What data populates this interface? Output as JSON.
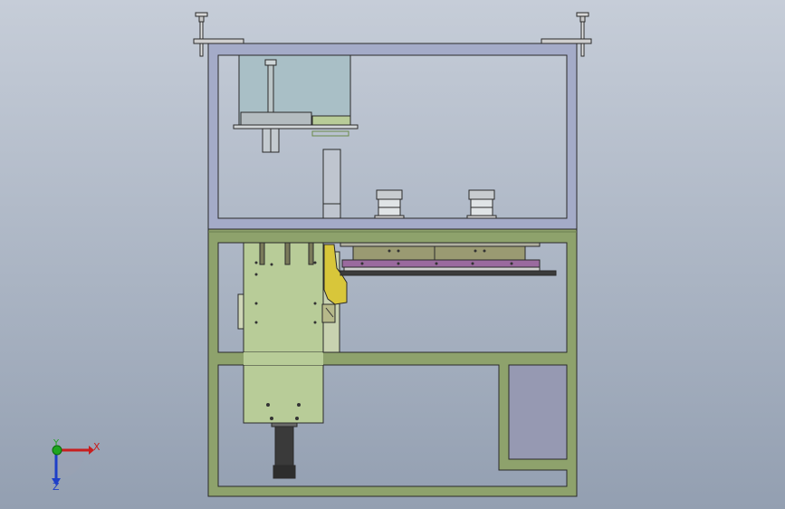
{
  "viewport": {
    "background_top": "#c6cdd8",
    "background_bottom": "#939fb1"
  },
  "colors": {
    "frame_upper": "#a4abc8",
    "frame_lower": "#8ea26c",
    "edge": "#2a2a2a",
    "glass": "#a9bfc6",
    "green_part": "#b8cc98",
    "olive_plate": "#9a9a72",
    "yellow_part": "#d8c63a",
    "purple_rail": "#9a6a9e",
    "cabinet": "#9699b2",
    "motor": "#3a3a3a"
  },
  "triad": {
    "x_label": "X",
    "y_label": "Y",
    "z_label": "Z",
    "x_color": "#c81e1e",
    "y_color": "#1fa51f",
    "z_color": "#1e3fc8"
  }
}
